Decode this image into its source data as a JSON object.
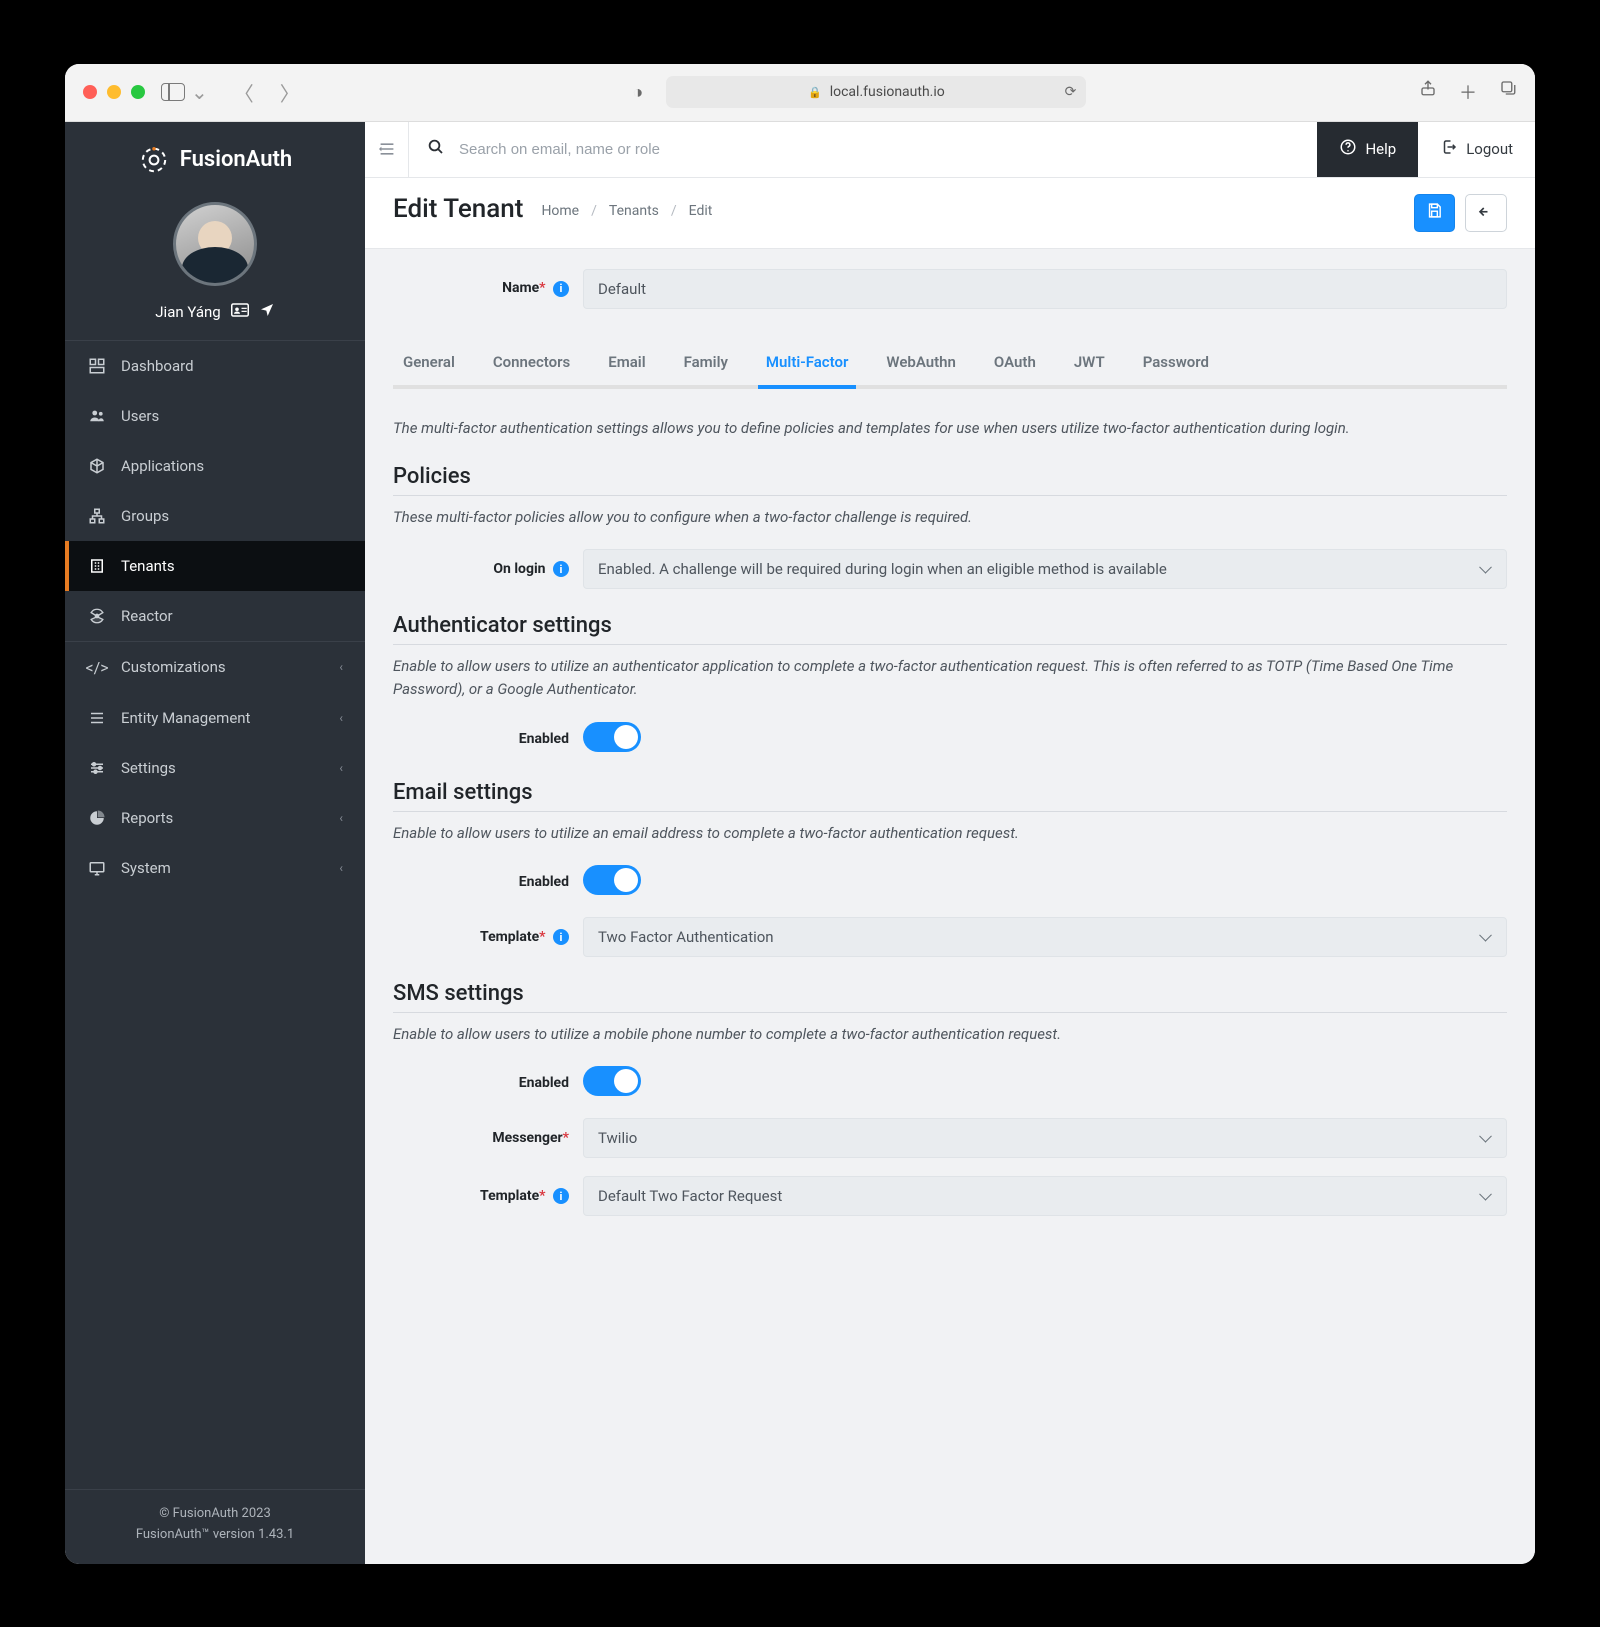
{
  "browser": {
    "url_host": "local.fusionauth.io"
  },
  "brand": "FusionAuth",
  "user": {
    "name": "Jian Yáng"
  },
  "topbar": {
    "search_placeholder": "Search on email, name or role",
    "help": "Help",
    "logout": "Logout"
  },
  "sidebar": {
    "items": [
      {
        "label": "Dashboard"
      },
      {
        "label": "Users"
      },
      {
        "label": "Applications"
      },
      {
        "label": "Groups"
      },
      {
        "label": "Tenants"
      },
      {
        "label": "Reactor"
      }
    ],
    "expandable": [
      {
        "label": "Customizations"
      },
      {
        "label": "Entity Management"
      },
      {
        "label": "Settings"
      },
      {
        "label": "Reports"
      },
      {
        "label": "System"
      }
    ],
    "footer_line1": "© FusionAuth 2023",
    "footer_line2": "FusionAuth™ version 1.43.1"
  },
  "page": {
    "title": "Edit Tenant",
    "crumbs": [
      "Home",
      "Tenants",
      "Edit"
    ]
  },
  "form": {
    "name_label": "Name",
    "name_value": "Default",
    "tabs": [
      "General",
      "Connectors",
      "Email",
      "Family",
      "Multi-Factor",
      "WebAuthn",
      "OAuth",
      "JWT",
      "Password"
    ],
    "active_tab": "Multi-Factor",
    "mfa_intro": "The multi-factor authentication settings allows you to define policies and templates for use when users utilize two-factor authentication during login.",
    "policies_heading": "Policies",
    "policies_desc": "These multi-factor policies allow you to configure when a two-factor challenge is required.",
    "on_login_label": "On login",
    "on_login_value": "Enabled. A challenge will be required during login when an eligible method is available",
    "auth_heading": "Authenticator settings",
    "auth_desc": "Enable to allow users to utilize an authenticator application to complete a two-factor authentication request. This is often referred to as TOTP (Time Based One Time Password), or a Google Authenticator.",
    "enabled_label": "Enabled",
    "email_heading": "Email settings",
    "email_desc": "Enable to allow users to utilize an email address to complete a two-factor authentication request.",
    "template_label": "Template",
    "email_template_value": "Two Factor Authentication",
    "sms_heading": "SMS settings",
    "sms_desc": "Enable to allow users to utilize a mobile phone number to complete a two-factor authentication request.",
    "messenger_label": "Messenger",
    "messenger_value": "Twilio",
    "sms_template_value": "Default Two Factor Request"
  }
}
